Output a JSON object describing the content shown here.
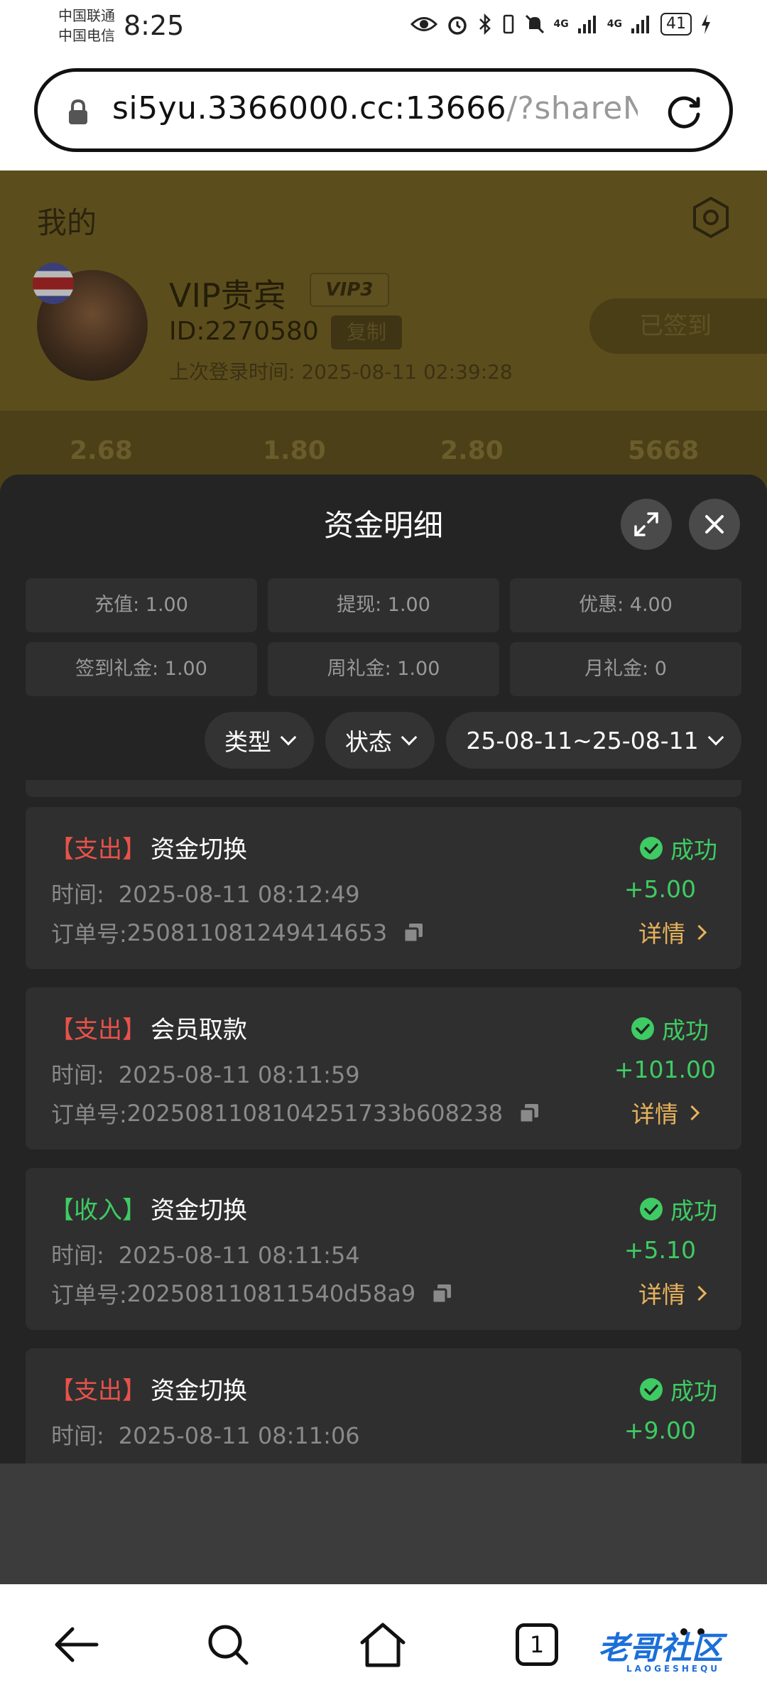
{
  "status_bar": {
    "carrier1": "中国联通",
    "carrier2": "中国电信",
    "time": "8:25",
    "network1": "4G",
    "network2": "4G",
    "battery": "41"
  },
  "browser": {
    "url_host": "si5yu.3366000.cc:13666",
    "url_path": "/?shareNa",
    "tab_count": "1"
  },
  "profile": {
    "page_title": "我的",
    "name": "VIP贵宾",
    "vip_level": "VIP3",
    "id": "ID:2270580",
    "copy_label": "复制",
    "last_login": "上次登录时间:  2025-08-11 02:39:28",
    "signed_label": "已签到",
    "stats": [
      "2.68",
      "1.80",
      "2.80",
      "5668"
    ]
  },
  "sheet": {
    "title": "资金明细",
    "summary": [
      "充值: 1.00",
      "提现: 1.00",
      "优惠: 4.00",
      "签到礼金: 1.00",
      "周礼金: 1.00",
      "月礼金: 0"
    ],
    "filters": {
      "type": "类型",
      "status": "状态",
      "date_range": "25-08-11~25-08-11"
    },
    "time_label": "时间:",
    "order_label": "订单号:",
    "detail_label": "详情",
    "records": [
      {
        "tag": "【支出】",
        "kind": "out",
        "type": "资金切换",
        "time": "2025-08-11 08:12:49",
        "order": "250811081249414653",
        "status": "成功",
        "amount": "+5.00"
      },
      {
        "tag": "【支出】",
        "kind": "out",
        "type": "会员取款",
        "time": "2025-08-11 08:11:59",
        "order": "20250811081042517 33b608238",
        "status": "成功",
        "amount": "+101.00"
      },
      {
        "tag": "【收入】",
        "kind": "in",
        "type": "资金切换",
        "time": "2025-08-11 08:11:54",
        "order": "202508110811540d58a9",
        "status": "成功",
        "amount": "+5.10"
      },
      {
        "tag": "【支出】",
        "kind": "out",
        "type": "资金切换",
        "time": "2025-08-11 08:11:06",
        "order": "",
        "status": "成功",
        "amount": "+9.00"
      }
    ]
  },
  "watermark": {
    "text": "老哥社区",
    "sub": "LAOGESHEQU"
  }
}
